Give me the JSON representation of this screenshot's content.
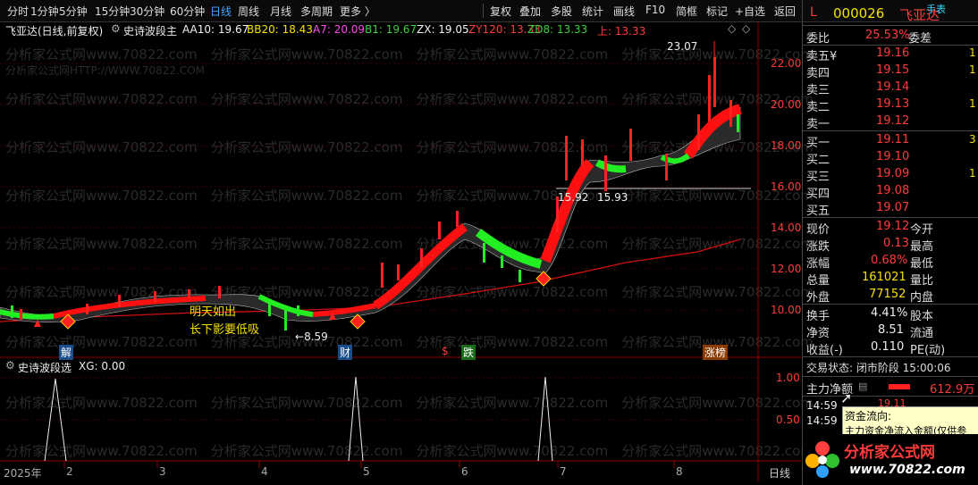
{
  "toolbar": {
    "left_items": [
      "分时",
      "1分钟",
      "5分钟",
      "15分钟",
      "30分钟",
      "60分钟",
      "日线",
      "周线",
      "月线",
      "多周期",
      "更多 〉"
    ],
    "active": "日线",
    "right_items": [
      "复权",
      "叠加",
      "多股",
      "统计",
      "画线",
      "F10",
      "简框",
      "标记",
      "+自选",
      "返回"
    ]
  },
  "chart": {
    "title_name": "飞亚达(日线,前复权)",
    "indicator_name": "史诗波段主",
    "params": [
      {
        "label": "AA10: 19.67",
        "color": "#f0f0f0"
      },
      {
        "label": "BB20: 18.43",
        "color": "#f5e000"
      },
      {
        "label": "A7: 20.09",
        "color": "#ff4af0"
      },
      {
        "label": "B1: 19.67",
        "color": "#3ad03a"
      },
      {
        "label": "ZX: 19.05",
        "color": "#f0f0f0"
      },
      {
        "label": "ZY120: 13.33",
        "color": "#ff3b3b"
      },
      {
        "label": "ZD8: 13.33",
        "color": "#3ad03a"
      },
      {
        "label": "上: 13.33",
        "color": "#ff3b3b"
      }
    ],
    "price_axis": [
      "22.00",
      "20.00",
      "18.00",
      "16.00",
      "14.00",
      "12.00",
      "10.00"
    ],
    "high_label": "23.07",
    "low_label": "8.59",
    "support_labels": [
      "15.92",
      "15.93"
    ],
    "annotation_line1": "明天如出",
    "annotation_line2": "长下影要低吸",
    "event_badges": [
      "解",
      "财",
      "$",
      "跌",
      "涨榜"
    ],
    "sub_title": "史诗波段选",
    "sub_value": "XG: 0.00",
    "sub_axis": [
      "1.00",
      "0.50"
    ],
    "time_axis": [
      "2025年",
      "2",
      "3",
      "4",
      "5",
      "6",
      "7",
      "8"
    ],
    "period_label": "日线",
    "watermark_cn": "分析家公式网www.70822.com",
    "watermark_http": "分析家公式网HTTP://WWW.70822.COM"
  },
  "quote": {
    "flag": "L",
    "code": "000026",
    "name": "飞亚达",
    "hand_label": "手表",
    "weibi_label": "委比",
    "weibi_value": "25.53%",
    "weicha_label": "委差",
    "sells": [
      {
        "label": "卖五",
        "mark": "¥",
        "price": "19.16",
        "vol": "1"
      },
      {
        "label": "卖四",
        "mark": "",
        "price": "19.15",
        "vol": "1"
      },
      {
        "label": "卖三",
        "mark": "",
        "price": "19.14",
        "vol": ""
      },
      {
        "label": "卖二",
        "mark": "",
        "price": "19.13",
        "vol": "1"
      },
      {
        "label": "卖一",
        "mark": "",
        "price": "19.12",
        "vol": ""
      }
    ],
    "buys": [
      {
        "label": "买一",
        "price": "19.11",
        "vol": "3"
      },
      {
        "label": "买二",
        "price": "19.10",
        "vol": ""
      },
      {
        "label": "买三",
        "price": "19.09",
        "vol": "1"
      },
      {
        "label": "买四",
        "price": "19.08",
        "vol": ""
      },
      {
        "label": "买五",
        "price": "19.07",
        "vol": ""
      }
    ],
    "stats": [
      {
        "label": "现价",
        "value": "19.12",
        "color": "#ff3b3b",
        "label2": "今开"
      },
      {
        "label": "涨跌",
        "value": "0.13",
        "color": "#ff3b3b",
        "label2": "最高"
      },
      {
        "label": "涨幅",
        "value": "0.68%",
        "color": "#ff3b3b",
        "label2": "最低"
      },
      {
        "label": "总量",
        "value": "161021",
        "color": "#f5e000",
        "label2": "量比"
      },
      {
        "label": "外盘",
        "value": "77152",
        "color": "#f5e000",
        "label2": "内盘"
      }
    ],
    "stats2": [
      {
        "label": "换手",
        "value": "4.41%",
        "label2": "股本"
      },
      {
        "label": "净资",
        "value": "8.51",
        "label2": "流通"
      },
      {
        "label": "收益(-)",
        "value": "0.110",
        "label2": "PE(动)"
      }
    ],
    "trade_status": "交易状态: 闭市阶段 15:00:06",
    "main_net_label": "主力净额",
    "main_net_value": "612.9万",
    "ticks": [
      "14:59",
      "14:59"
    ],
    "tick_price": "19.11",
    "popup_title": "资金流向:",
    "popup_text": "主力资金净流入金额(仅供参",
    "logo_text": "分析家公式网",
    "logo_url": "www.70822.com"
  }
}
